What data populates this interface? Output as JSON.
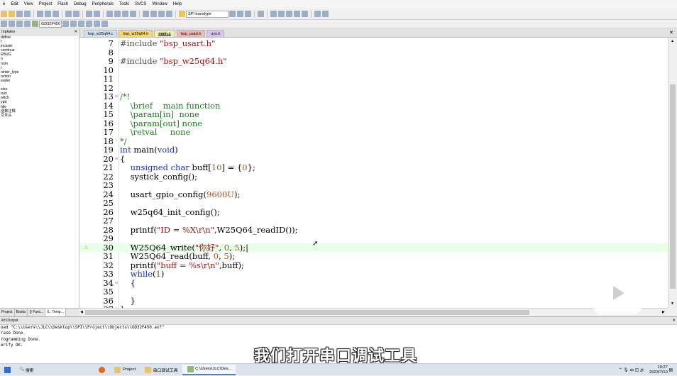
{
  "menu": [
    "e",
    "Edit",
    "View",
    "Project",
    "Flash",
    "Debug",
    "Peripherals",
    "Tools",
    "SVCS",
    "Window",
    "Help"
  ],
  "toolbar": {
    "combo_text": "SPI transtype",
    "target_text": "GD32F450"
  },
  "left_panel": {
    "title": "mplates",
    "items": [
      "define",
      "f",
      "include",
      "continue",
      "EBUG",
      "o",
      "num",
      "r",
      "ointer_type",
      "nction",
      "eader",
      "",
      "else",
      "ruct",
      "witch",
      "ypd",
      "hile",
      "函数注释",
      "文件头"
    ],
    "tabs": [
      "Project",
      "Books",
      "{} Func...",
      "0.. Temp..."
    ]
  },
  "file_tabs": [
    "bsp_w25q64.c",
    "bsp_w25q64.h",
    "main.c",
    "bsp_usart.h",
    "sys.h"
  ],
  "code_lines": [
    {
      "n": "7",
      "parts": [
        {
          "t": "#include ",
          "c": "pp"
        },
        {
          "t": "\"bsp_usart.h\"",
          "c": "str"
        }
      ]
    },
    {
      "n": "8",
      "parts": []
    },
    {
      "n": "9",
      "parts": [
        {
          "t": "#include ",
          "c": "pp"
        },
        {
          "t": "\"bsp_w25q64.h\"",
          "c": "str"
        }
      ]
    },
    {
      "n": "10",
      "parts": []
    },
    {
      "n": "11",
      "parts": []
    },
    {
      "n": "12",
      "parts": []
    },
    {
      "n": "13",
      "fold": "⊟",
      "parts": [
        {
          "t": "/*!",
          "c": "cmt"
        }
      ]
    },
    {
      "n": "14",
      "parts": [
        {
          "t": "    \\brief    main function",
          "c": "cmt"
        }
      ]
    },
    {
      "n": "15",
      "parts": [
        {
          "t": "    \\param[in]  none",
          "c": "cmt"
        }
      ]
    },
    {
      "n": "16",
      "parts": [
        {
          "t": "    \\param[out] none",
          "c": "cmt"
        }
      ]
    },
    {
      "n": "17",
      "parts": [
        {
          "t": "    \\retval     none",
          "c": "cmt"
        }
      ]
    },
    {
      "n": "18",
      "fold": "└",
      "parts": [
        {
          "t": "*/",
          "c": "cmt"
        }
      ]
    },
    {
      "n": "19",
      "parts": [
        {
          "t": "int ",
          "c": "kw"
        },
        {
          "t": "main(",
          "c": ""
        },
        {
          "t": "void",
          "c": "kw"
        },
        {
          "t": ")",
          "c": ""
        }
      ]
    },
    {
      "n": "20",
      "fold": "⊟",
      "parts": [
        {
          "t": "{",
          "c": ""
        }
      ]
    },
    {
      "n": "21",
      "parts": [
        {
          "t": "    ",
          "c": ""
        },
        {
          "t": "unsigned char ",
          "c": "kw"
        },
        {
          "t": "buff[",
          "c": ""
        },
        {
          "t": "10",
          "c": "num"
        },
        {
          "t": "] = {",
          "c": ""
        },
        {
          "t": "0",
          "c": "num"
        },
        {
          "t": "};",
          "c": ""
        }
      ]
    },
    {
      "n": "22",
      "parts": [
        {
          "t": "    systick_config();",
          "c": ""
        }
      ]
    },
    {
      "n": "23",
      "parts": []
    },
    {
      "n": "24",
      "parts": [
        {
          "t": "    usart_gpio_config(",
          "c": ""
        },
        {
          "t": "9600U",
          "c": "num"
        },
        {
          "t": ");",
          "c": ""
        }
      ]
    },
    {
      "n": "25",
      "parts": []
    },
    {
      "n": "26",
      "parts": [
        {
          "t": "    w25q64_init_config();",
          "c": ""
        }
      ]
    },
    {
      "n": "27",
      "parts": []
    },
    {
      "n": "28",
      "parts": [
        {
          "t": "    printf(",
          "c": ""
        },
        {
          "t": "\"ID = %X\\r\\n\"",
          "c": "str"
        },
        {
          "t": ",W25Q64_readID());",
          "c": ""
        }
      ]
    },
    {
      "n": "29",
      "parts": []
    },
    {
      "n": "30",
      "hl": true,
      "warn": "⚠",
      "parts": [
        {
          "t": "    W25Q64_write(",
          "c": ""
        },
        {
          "t": "\"你好\"",
          "c": "str"
        },
        {
          "t": ", ",
          "c": ""
        },
        {
          "t": "0",
          "c": "num"
        },
        {
          "t": ", ",
          "c": ""
        },
        {
          "t": "5",
          "c": "num"
        },
        {
          "t": ");|",
          "c": ""
        }
      ]
    },
    {
      "n": "31",
      "parts": [
        {
          "t": "    W25Q64_read(buff, ",
          "c": ""
        },
        {
          "t": "0",
          "c": "num"
        },
        {
          "t": ", ",
          "c": ""
        },
        {
          "t": "5",
          "c": "num"
        },
        {
          "t": ");",
          "c": ""
        }
      ]
    },
    {
      "n": "32",
      "parts": [
        {
          "t": "    printf(",
          "c": ""
        },
        {
          "t": "\"buff = %s\\r\\n\"",
          "c": "str"
        },
        {
          "t": ",buff);",
          "c": ""
        }
      ]
    },
    {
      "n": "33",
      "parts": [
        {
          "t": "    ",
          "c": ""
        },
        {
          "t": "while",
          "c": "kw"
        },
        {
          "t": "(",
          "c": ""
        },
        {
          "t": "1",
          "c": "num"
        },
        {
          "t": ")",
          "c": ""
        }
      ]
    },
    {
      "n": "34",
      "fold": "⊟",
      "parts": [
        {
          "t": "    {",
          "c": ""
        }
      ]
    },
    {
      "n": "35",
      "parts": []
    },
    {
      "n": "36",
      "parts": [
        {
          "t": "    }",
          "c": ""
        }
      ]
    },
    {
      "n": "37",
      "fold": "└",
      "parts": [
        {
          "t": "}",
          "c": ""
        }
      ]
    }
  ],
  "build_output": {
    "title": "ild Output",
    "lines": [
      "oad \"C:\\\\Users\\\\JLC\\\\Desktop\\\\SPI\\\\Project\\\\Objects\\\\GD32F450.axf\"",
      "rase Done.",
      "rogramming Done.",
      "erify OK."
    ]
  },
  "subtitle": "我们打开串口调试工具",
  "taskbar": {
    "search": "搜索",
    "items": [
      "Project",
      "串口调试工具",
      "C:\\Users\\JLC\\Des..."
    ],
    "time": "19:27",
    "date": "2023/7/10"
  }
}
